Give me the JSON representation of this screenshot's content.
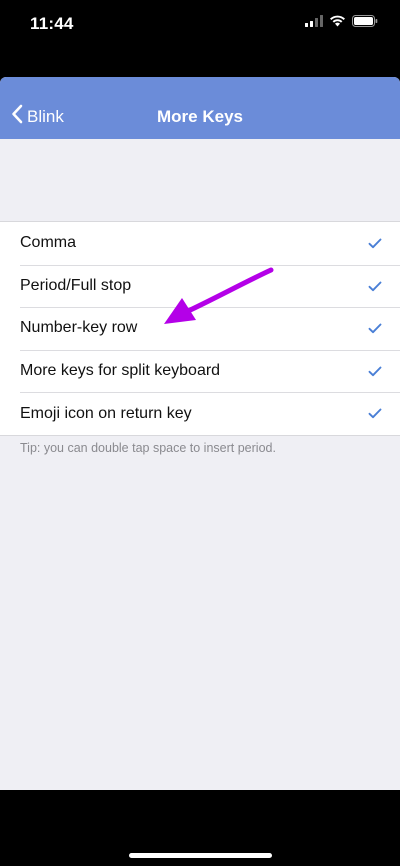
{
  "status_bar": {
    "time": "11:44",
    "icons": [
      "cellular-signal-icon",
      "wifi-icon",
      "battery-icon"
    ]
  },
  "nav": {
    "back_label": "Blink",
    "title": "More Keys"
  },
  "settings": {
    "items": [
      {
        "label": "Comma",
        "checked": true
      },
      {
        "label": "Period/Full stop",
        "checked": true
      },
      {
        "label": "Number-key row",
        "checked": true
      },
      {
        "label": "More keys for split keyboard",
        "checked": true
      },
      {
        "label": "Emoji icon on return key",
        "checked": true
      }
    ],
    "tip": "Tip: you can double tap space to insert period."
  },
  "colors": {
    "nav_bar": "#6b8cd9",
    "background": "#efeff4",
    "checkmark": "#4a7fd6",
    "annotation_arrow": "#b400e8"
  }
}
